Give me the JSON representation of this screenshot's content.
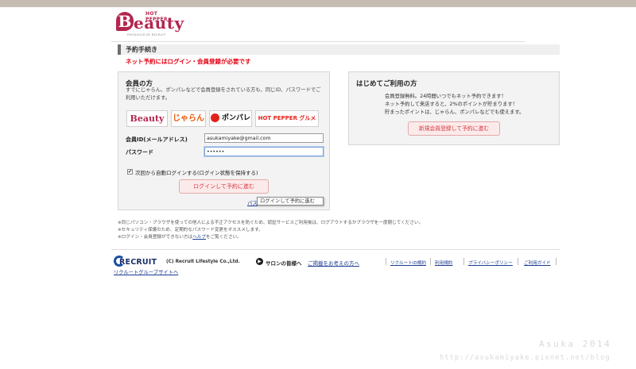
{
  "header": {
    "logo": {
      "hotpepper": "HOT PEPPER",
      "brand_letter": "B",
      "brand_rest": "eauty",
      "produced_by": "PRODUCED BY RECRUIT"
    }
  },
  "page": {
    "section_title": "予約手続き",
    "required_note": "ネット予約にはログイン・会員登録が必要です"
  },
  "member": {
    "heading": "会員の方",
    "description": "すでにじゃらん、ポンパレなどで会員登録をされている方も、同じID、パスワードでご利用いただけます。",
    "brands": [
      "Beauty",
      "じゃらん",
      "ポンパレ",
      "HOT PEPPER グルメ"
    ],
    "id_label": "会員ID(メールアドレス)",
    "id_value": "asukamiyake@gmail.com",
    "password_label": "パスワード",
    "password_value": "••••••",
    "auto_login_checked": "✔",
    "auto_login_label": "次回から自動ログインする(ログイン状態を保持する)",
    "login_button": "ログインして予約に進む",
    "forgot_prefix": "パス",
    "tooltip": "ログインして予約に進む"
  },
  "new_user": {
    "heading": "はじめてご利用の方",
    "lines": [
      "会員登録無料。24時間いつでもネット予約できます！",
      "ネット予約して来店すると、2%のポイントが貯まります！",
      "貯まったポイントは、じゃらん、ポンパレなどでも使えます。"
    ],
    "register_button": "新規会員登録して予約に進む"
  },
  "notes": {
    "line1": "※同じパソコン・ブラウザを使っての他人による不正アクセスを防ぐため、認証サービスご利用後は、ログアウトするかブラウザを一度閉じてください。",
    "line2": "※セキュリティ保護のため、定期的なパスワード変更をオススメします。",
    "line3_before": "※ログイン・会員登録ができない方は",
    "line3_link": "ヘルプ",
    "line3_after": "をご覧ください。"
  },
  "footer": {
    "recruit_logo": "RECRUIT",
    "copyright": "(C) Recruit Lifestyle Co.,Ltd.",
    "group_link": "リクルートグループサイトへ",
    "salon_label": "サロンの皆様へ",
    "salon_link": "ご掲載をお考えの方へ",
    "links": [
      "リクルートID規約",
      "利用規約",
      "プライバシーポリシー",
      "ご利用ガイド"
    ]
  },
  "watermark": {
    "signature": "Asuka 2014",
    "url": "http://asukamiyake.pixnet.net/blog"
  }
}
